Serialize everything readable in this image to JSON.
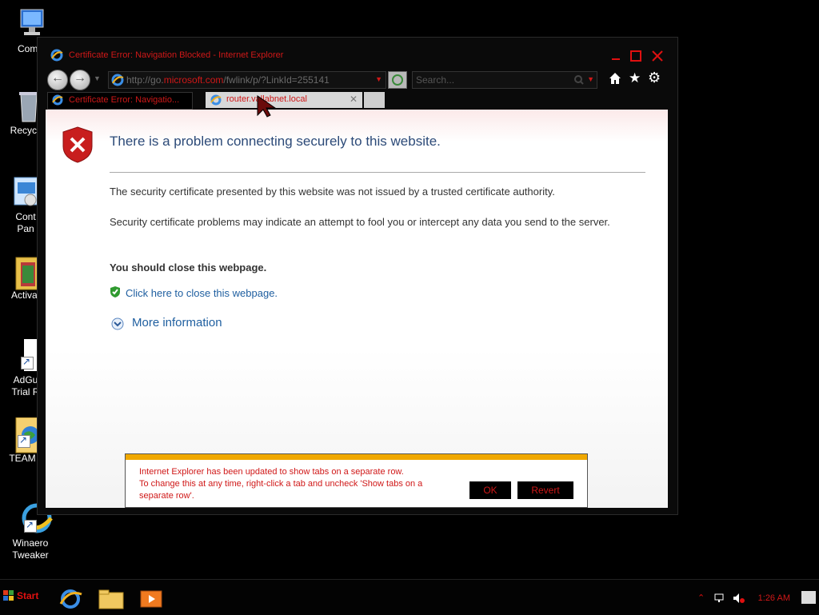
{
  "desktop": {
    "icons": [
      {
        "label": "Comp"
      },
      {
        "label": "Recycle"
      },
      {
        "label": "Cont\nPan"
      },
      {
        "label": "Activat"
      },
      {
        "label": "AdGu\nTrial R"
      },
      {
        "label": "TEAM"
      },
      {
        "label": "Winaero\nTweaker"
      }
    ]
  },
  "window": {
    "title": "Certificate Error: Navigation Blocked - Internet Explorer",
    "address": {
      "prefix": "http://go.",
      "domain": "microsoft.com",
      "rest": "/fwlink/p/?LinkId=255141"
    },
    "search_placeholder": "Search...",
    "tabs": [
      {
        "label": "Certificate Error: Navigatio..."
      },
      {
        "label": "router.vallabnet.local"
      }
    ]
  },
  "page": {
    "heading": "There is a problem connecting securely to this website.",
    "para1": "The security certificate presented by this website was not issued by a trusted certificate authority.",
    "para2": "Security certificate problems may indicate an attempt to fool you or intercept any data you send to the server.",
    "recommend": "You should close this webpage.",
    "close_link": "Click here to close this webpage.",
    "more_info": "More information"
  },
  "notification": {
    "line1": "Internet Explorer has been updated to show tabs on a separate row.",
    "line2": "To change this at any time, right-click a tab and uncheck 'Show tabs on a",
    "line3": "separate row'.",
    "ok": "OK",
    "revert": "Revert"
  },
  "taskbar": {
    "start": "Start",
    "clock": "1:26 AM"
  },
  "colors": {
    "accent_red": "#d01818",
    "link_blue": "#1f5fa0",
    "heading_blue": "#2c4a78",
    "notify_bar": "#f0a800"
  }
}
